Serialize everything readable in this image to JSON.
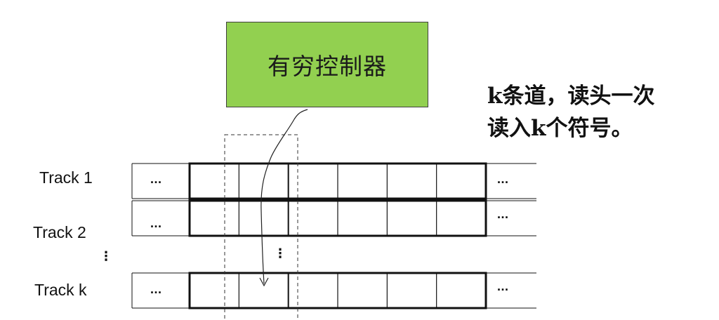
{
  "controller": {
    "label": "有穷控制器",
    "fill": "#92d050"
  },
  "caption": {
    "lines": [
      "k条道，读头一次",
      "读入k个符号。"
    ]
  },
  "tracks": [
    {
      "label": "Track 1",
      "left_ellipsis": "...",
      "right_ellipsis": "..."
    },
    {
      "label": "Track 2",
      "left_ellipsis": "...",
      "right_ellipsis": "..."
    },
    {
      "label": "Track k",
      "left_ellipsis": "...",
      "right_ellipsis": "..."
    }
  ],
  "vertical_ellipsis": "⋮",
  "cells_per_track": 6
}
